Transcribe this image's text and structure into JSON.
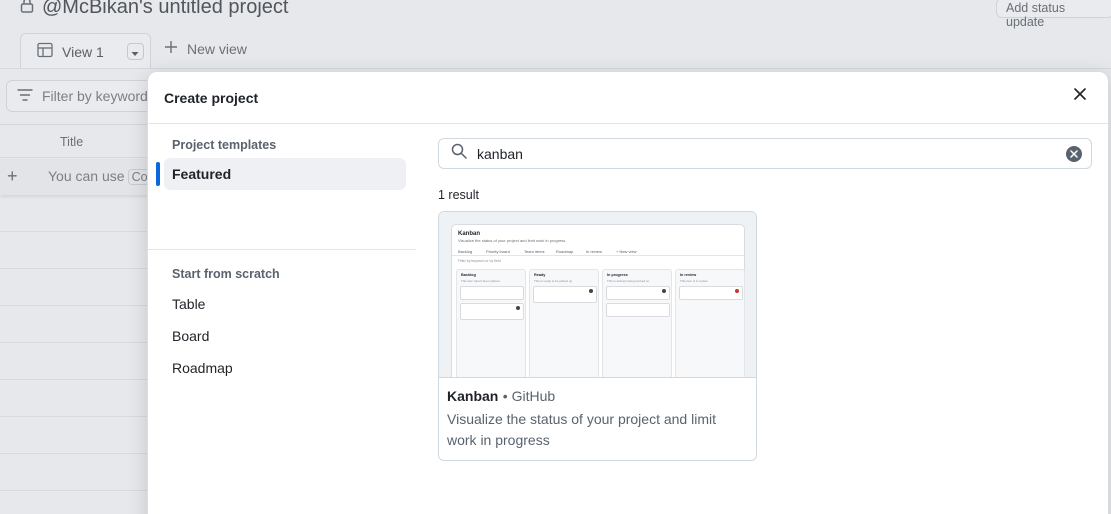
{
  "background": {
    "project_title": "@McBikan's untitled project",
    "status_button": "Add status update",
    "view_tab": "View 1",
    "new_view": "New view",
    "filter_placeholder": "Filter by keyword",
    "column_title": "Title",
    "row_hint": "You can use",
    "row_hint_code": "Co"
  },
  "modal": {
    "title": "Create project",
    "sidebar": {
      "templates_heading": "Project templates",
      "featured": "Featured",
      "scratch_heading": "Start from scratch",
      "scratch_items": [
        "Table",
        "Board",
        "Roadmap"
      ]
    },
    "search": {
      "value": "kanban"
    },
    "result_count": "1 result",
    "result": {
      "name": "Kanban",
      "owner": "• GitHub",
      "description": "Visualize the status of your project and limit work in progress",
      "preview": {
        "title": "Kanban",
        "subtitle": "Visualize the status of your project and limit work in progress",
        "tabs": [
          "Backlog",
          "Priority board",
          "Team items",
          "Roadmap",
          "In review",
          "+ New view"
        ],
        "filter": "Filter by keyword or by field",
        "columns": [
          {
            "title": "Backlog",
            "desc": "This item hasn't been started"
          },
          {
            "title": "Ready",
            "desc": "This is ready to be picked up"
          },
          {
            "title": "In progress",
            "desc": "This is actively being worked on"
          },
          {
            "title": "In review",
            "desc": "This item is in review"
          }
        ]
      }
    }
  }
}
